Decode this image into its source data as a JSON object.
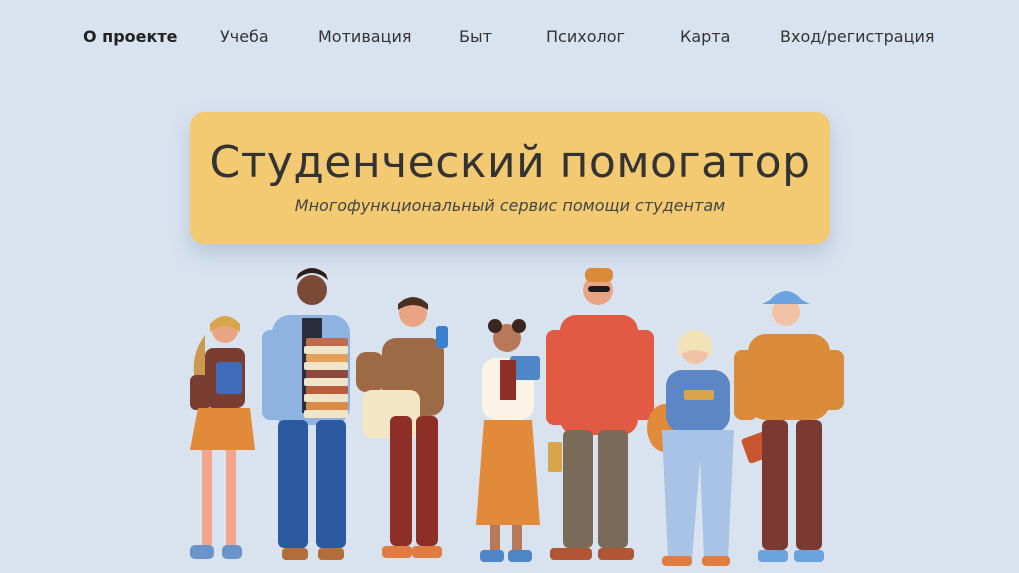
{
  "nav": {
    "items": [
      {
        "label": "О проекте",
        "active": true
      },
      {
        "label": "Учеба"
      },
      {
        "label": "Мотивация"
      },
      {
        "label": "Быт"
      },
      {
        "label": "Психолог"
      },
      {
        "label": "Карта"
      },
      {
        "label": "Вход/регистрация"
      }
    ]
  },
  "hero": {
    "title": "Студенческий помогатор",
    "subtitle": "Многофункциональный сервис помощи студентам"
  },
  "colors": {
    "background": "#d9e3f0",
    "hero_card": "#f3ca72",
    "text": "#333333"
  },
  "illustration": {
    "name": "students-group-illustration",
    "figures": [
      "student-girl-orange-skirt",
      "student-with-books",
      "student-with-phone",
      "student-girl-with-book",
      "student-red-shirt",
      "student-girl-blonde",
      "student-bucket-hat"
    ]
  }
}
